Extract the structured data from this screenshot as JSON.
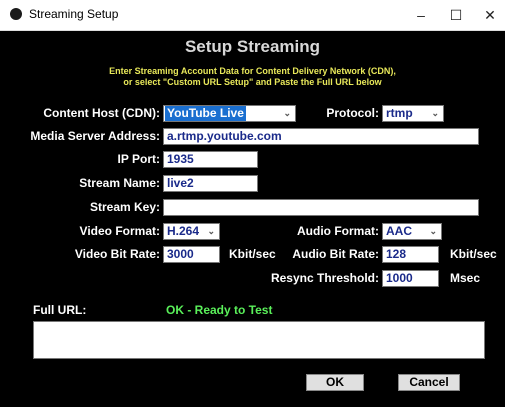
{
  "window": {
    "title": "Streaming Setup",
    "minimize": "–",
    "maximize": "☐",
    "close": "✕"
  },
  "heading": "Setup Streaming",
  "note_line1": "Enter Streaming Account Data for Content Delivery Network (CDN),",
  "note_line2": "or select \"Custom URL Setup\" and Paste the Full URL below",
  "form": {
    "content_host_label": "Content Host (CDN):",
    "content_host_value": "YouTube Live",
    "protocol_label": "Protocol:",
    "protocol_value": "rtmp",
    "media_server_label": "Media Server Address:",
    "media_server_value": "a.rtmp.youtube.com",
    "ip_port_label": "IP Port:",
    "ip_port_value": "1935",
    "stream_name_label": "Stream Name:",
    "stream_name_value": "live2",
    "stream_key_label": "Stream Key:",
    "stream_key_value": "",
    "video_format_label": "Video Format:",
    "video_format_value": "H.264",
    "audio_format_label": "Audio Format:",
    "audio_format_value": "AAC",
    "video_bitrate_label": "Video Bit Rate:",
    "video_bitrate_value": "3000",
    "video_bitrate_unit": "Kbit/sec",
    "audio_bitrate_label": "Audio Bit Rate:",
    "audio_bitrate_value": "128",
    "audio_bitrate_unit": "Kbit/sec",
    "resync_label": "Resync Threshold:",
    "resync_value": "1000",
    "resync_unit": "Msec"
  },
  "full_url_label": "Full URL:",
  "status_text": "OK - Ready to Test",
  "full_url_value": "",
  "buttons": {
    "ok": "OK",
    "cancel": "Cancel"
  },
  "icons": {
    "app": "app-icon",
    "dropdown": "chevron-down-icon"
  },
  "colors": {
    "background": "#000000",
    "label": "#ffffff",
    "note": "#e8e85a",
    "status_ok": "#5af05a",
    "field_text": "#1a2a8a",
    "selection": "#1a6fd0"
  }
}
